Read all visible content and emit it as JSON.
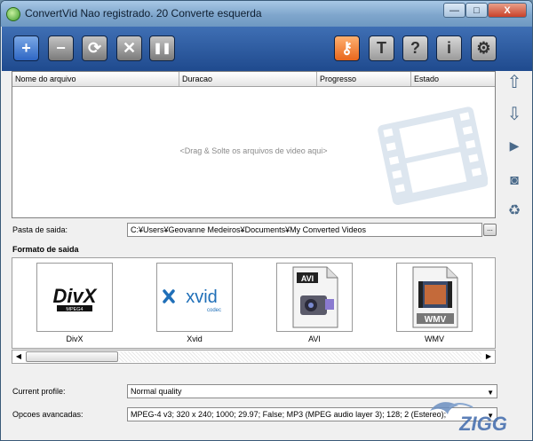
{
  "window": {
    "title": "ConvertVid Nao registrado. 20 Converte esquerda",
    "minimize_glyph": "—",
    "maximize_glyph": "□",
    "close_glyph": "X"
  },
  "toolbar": {
    "add_glyph": "+",
    "remove_glyph": "−",
    "refresh_glyph": "⟳",
    "cancel_glyph": "✕",
    "pause_glyph": "❚❚",
    "key_glyph": "⚷",
    "text_glyph": "T",
    "help_glyph": "?",
    "info_glyph": "i",
    "settings_glyph": "⚙"
  },
  "file_list": {
    "columns": [
      "Nome do arquivo",
      "Duracao",
      "Progresso",
      "Estado"
    ],
    "drop_hint": "<Drag & Solte os arquivos de video aqui>"
  },
  "side_buttons": {
    "up_glyph": "⇧",
    "down_glyph": "⇩",
    "play_glyph": "▶",
    "snapshot_glyph": "◙",
    "trash_glyph": "♻"
  },
  "output": {
    "label": "Pasta de saida:",
    "path": "C:¥Users¥Geovanne Medeiros¥Documents¥My Converted Videos",
    "browse_label": "..."
  },
  "formats": {
    "heading": "Formato de saida",
    "items": [
      {
        "label": "DivX",
        "logo_text": "DivX",
        "logo_sub": "MPEG4"
      },
      {
        "label": "Xvid",
        "logo_text": "xvid",
        "logo_sub": "codec"
      },
      {
        "label": "AVI",
        "logo_text": "AVI",
        "logo_sub": ""
      },
      {
        "label": "WMV",
        "logo_text": "WMV",
        "logo_sub": ""
      }
    ]
  },
  "scrollbar": {
    "left_glyph": "◀",
    "right_glyph": "▶"
  },
  "profile": {
    "label": "Current profile:",
    "value": "Normal quality"
  },
  "advanced": {
    "label": "Opcoes avancadas:",
    "value": "MPEG-4 v3; 320 x 240; 1000; 29.97; False; MP3 (MPEG audio layer 3); 128; 2 (Estereo);"
  },
  "watermark": {
    "text": "ZIGG"
  },
  "colors": {
    "toolbar": "#2a5aa0",
    "accent_orange": "#e8661c",
    "title_bar": "#8fb4d8"
  }
}
